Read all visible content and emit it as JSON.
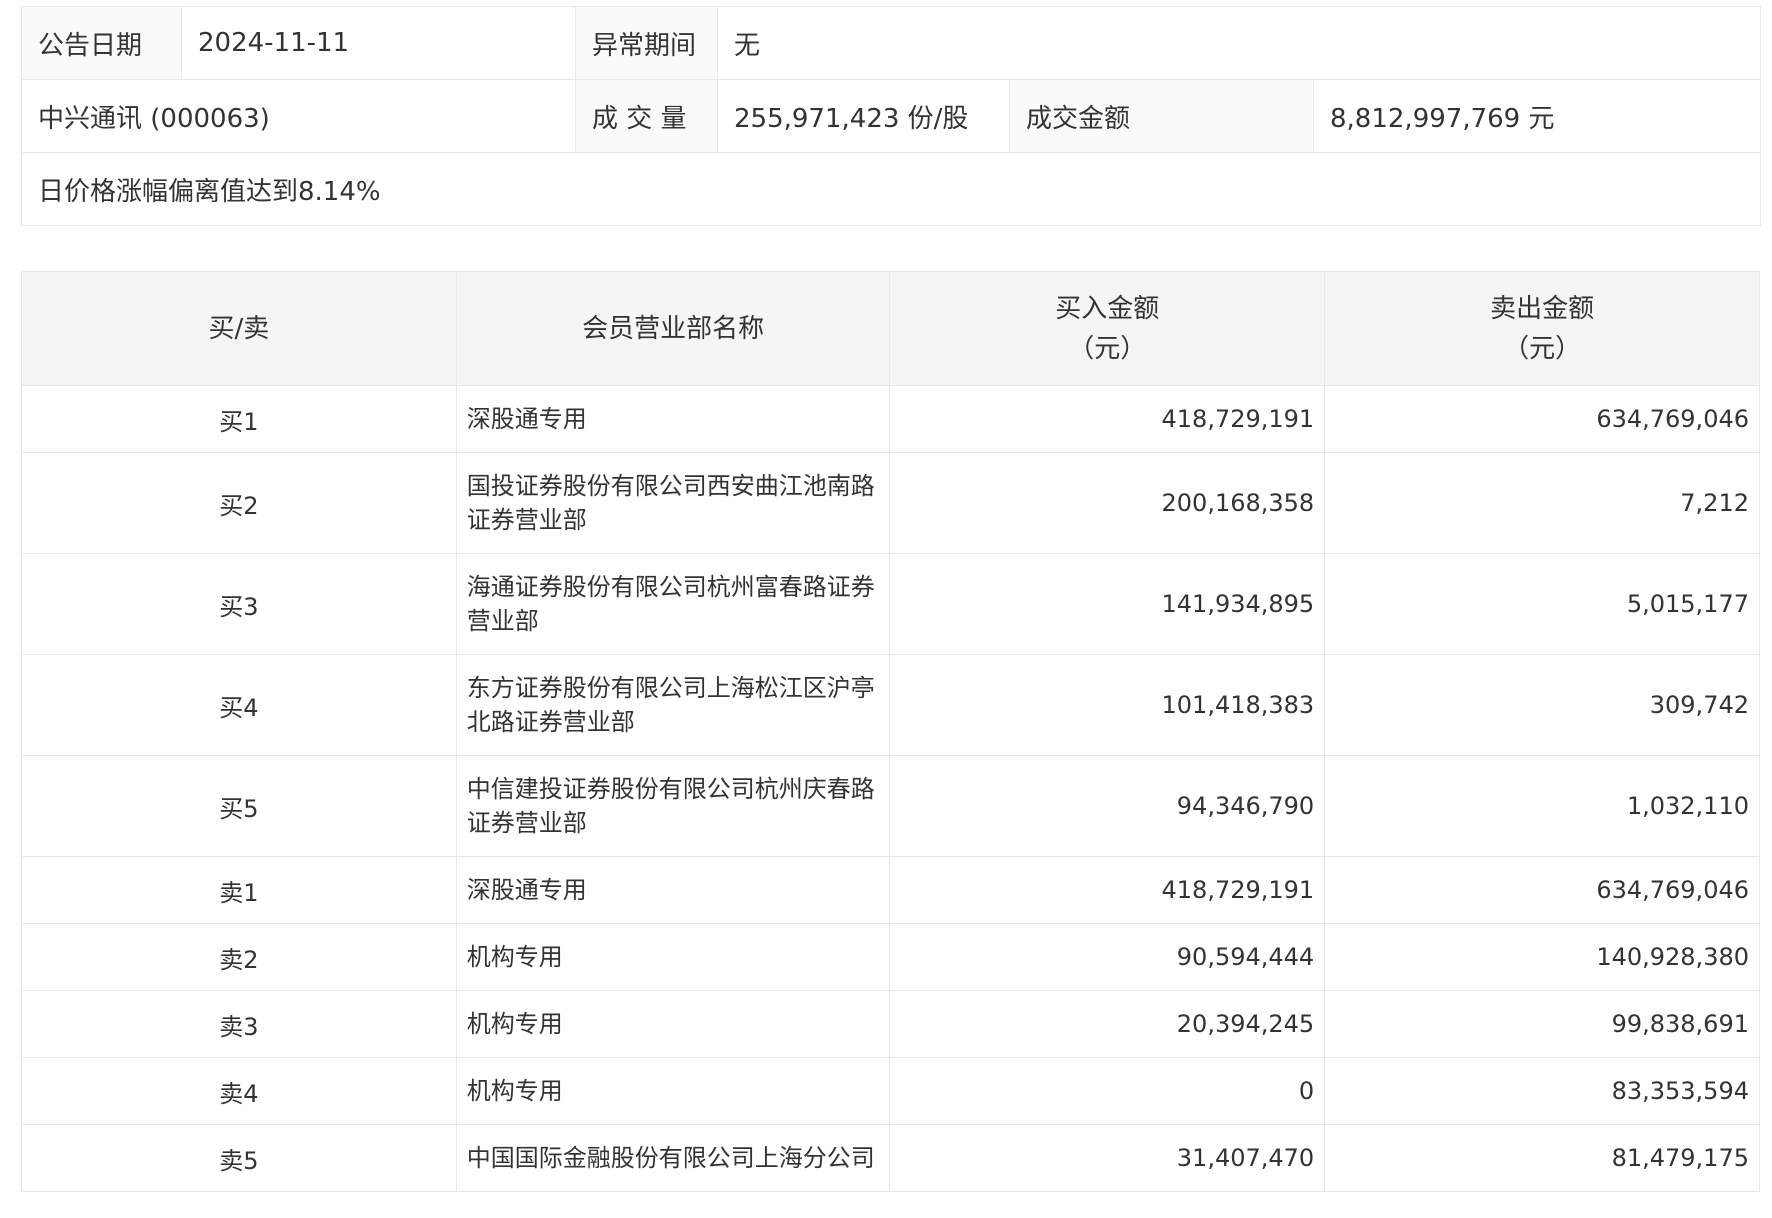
{
  "summary": {
    "date_label": "公告日期",
    "date_value": "2024-11-11",
    "period_label": "异常期间",
    "period_value": "无",
    "stock_name": "中兴通讯 (000063)",
    "volume_label": "成 交 量",
    "volume_value": "255,971,423 份/股",
    "amount_label": "成交金额",
    "amount_value": "8,812,997,769 元",
    "reason": "日价格涨幅偏离值达到8.14%"
  },
  "detail": {
    "headers": {
      "side": "买/卖",
      "name": "会员营业部名称",
      "buy_line1": "买入金额",
      "buy_line2": "（元）",
      "sell_line1": "卖出金额",
      "sell_line2": "（元）"
    },
    "rows": [
      {
        "side": "买1",
        "name": "深股通专用",
        "buy": "418,729,191",
        "sell": "634,769,046"
      },
      {
        "side": "买2",
        "name": "国投证券股份有限公司西安曲江池南路证券营业部",
        "buy": "200,168,358",
        "sell": "7,212"
      },
      {
        "side": "买3",
        "name": "海通证券股份有限公司杭州富春路证券营业部",
        "buy": "141,934,895",
        "sell": "5,015,177"
      },
      {
        "side": "买4",
        "name": "东方证券股份有限公司上海松江区沪亭北路证券营业部",
        "buy": "101,418,383",
        "sell": "309,742"
      },
      {
        "side": "买5",
        "name": "中信建投证券股份有限公司杭州庆春路证券营业部",
        "buy": "94,346,790",
        "sell": "1,032,110"
      },
      {
        "side": "卖1",
        "name": "深股通专用",
        "buy": "418,729,191",
        "sell": "634,769,046"
      },
      {
        "side": "卖2",
        "name": "机构专用",
        "buy": "90,594,444",
        "sell": "140,928,380"
      },
      {
        "side": "卖3",
        "name": "机构专用",
        "buy": "20,394,245",
        "sell": "99,838,691"
      },
      {
        "side": "卖4",
        "name": "机构专用",
        "buy": "0",
        "sell": "83,353,594"
      },
      {
        "side": "卖5",
        "name": "中国国际金融股份有限公司上海分公司",
        "buy": "31,407,470",
        "sell": "81,479,175"
      }
    ]
  }
}
